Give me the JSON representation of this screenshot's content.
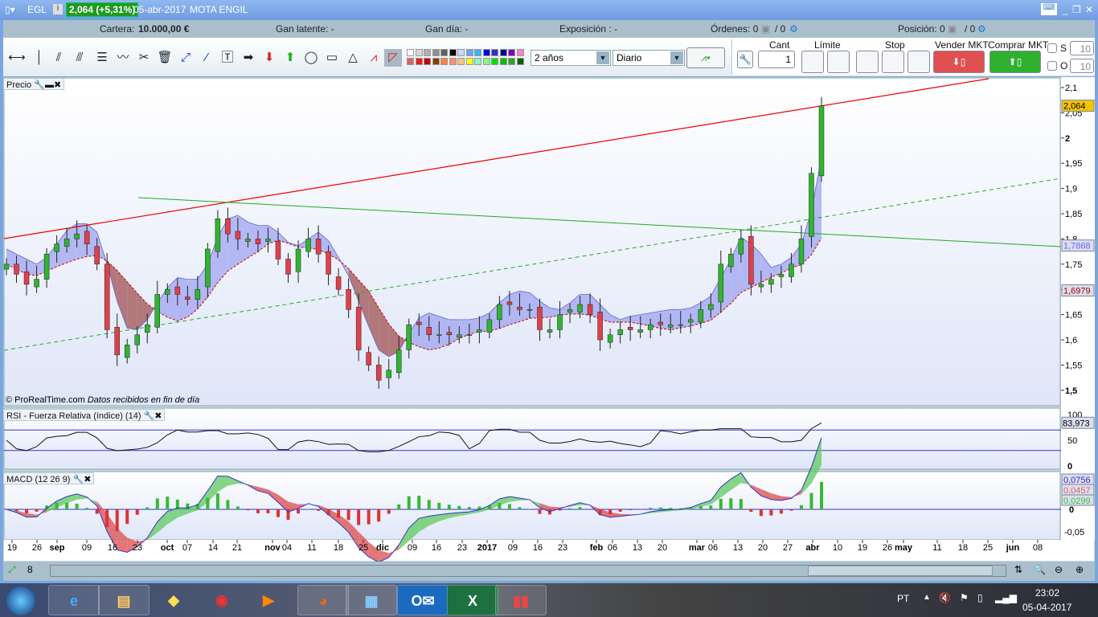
{
  "title": {
    "ticker": "EGL",
    "price": "2,064 (+5,31%)",
    "date": "05-abr-2017",
    "name": "MOTA ENGIL"
  },
  "info": {
    "cartera_label": "Cartera:",
    "cartera_value": "10.000,00 €",
    "gan_latente": "Gan latente: -",
    "gan_dia": "Gan día: -",
    "exposicion": "Exposición : -",
    "ordenes": "Órdenes: 0",
    "ordenes_b": "/ 0",
    "posicion": "Posición: 0",
    "posicion_b": "/ 0"
  },
  "toolbar": {
    "period": "2 años",
    "interval": "Diario",
    "cant_label": "Cant",
    "cant_value": "1",
    "limite_label": "Límite",
    "stop_label": "Stop",
    "sell_label": "Vender MKT",
    "buy_label": "Comprar MKT",
    "s_label": "S",
    "s_value": "10",
    "o_label": "O",
    "o_value": "10"
  },
  "colors": {
    "palette": [
      "#ffffff",
      "#d8d8d8",
      "#b0b0b0",
      "#909090",
      "#606060",
      "#000000",
      "#c8d8ff",
      "#6aa0ff",
      "#40b0ff",
      "#0000e0",
      "#3030c0",
      "#000090",
      "#8000c0",
      "#ff80c0",
      "#e06060",
      "#e02020",
      "#c00000",
      "#804000",
      "#ff8040",
      "#ff9070",
      "#ffc080",
      "#ffff00",
      "#80ffc0",
      "#80ff80",
      "#00e000",
      "#00c000",
      "#30a030",
      "#006000"
    ],
    "up": "#2fb52f",
    "down": "#e0404a"
  },
  "panels": {
    "price": "Precio",
    "rsi": "RSI - Fuerza Relativa (índice) (14)",
    "macd": "MACD (12 26 9)",
    "copyright": "© ProRealTime.com",
    "data_note": "Datos recibidos en fin de día"
  },
  "chart_data": [
    {
      "type": "candlestick",
      "title": "Precio",
      "ylim": [
        1.47,
        2.12
      ],
      "yticks": [
        "2,1",
        "2,05",
        "2",
        "1,95",
        "1,9",
        "1,85",
        "1,8",
        "1,75",
        "1,7",
        "1,65",
        "1,6",
        "1,55",
        "1,5"
      ],
      "ytick_values": [
        2.1,
        2.05,
        2,
        1.95,
        1.9,
        1.85,
        1.8,
        1.75,
        1.7,
        1.65,
        1.6,
        1.55,
        1.5
      ],
      "closes": [
        1.75,
        1.73,
        1.71,
        1.72,
        1.77,
        1.79,
        1.8,
        1.81,
        1.79,
        1.75,
        1.62,
        1.57,
        1.59,
        1.61,
        1.63,
        1.69,
        1.7,
        1.69,
        1.68,
        1.7,
        1.78,
        1.84,
        1.81,
        1.8,
        1.8,
        1.79,
        1.8,
        1.76,
        1.73,
        1.78,
        1.8,
        1.77,
        1.73,
        1.7,
        1.66,
        1.58,
        1.55,
        1.52,
        1.54,
        1.58,
        1.63,
        1.63,
        1.61,
        1.61,
        1.61,
        1.61,
        1.61,
        1.62,
        1.64,
        1.67,
        1.67,
        1.66,
        1.66,
        1.62,
        1.62,
        1.65,
        1.66,
        1.67,
        1.65,
        1.6,
        1.61,
        1.62,
        1.62,
        1.62,
        1.63,
        1.63,
        1.63,
        1.63,
        1.64,
        1.66,
        1.67,
        1.75,
        1.77,
        1.8,
        1.71,
        1.71,
        1.72,
        1.73,
        1.75,
        1.8,
        1.93,
        2.064
      ],
      "labels": {
        "last": "2,064",
        "line_green": "1,7868",
        "line_red": "1,6979"
      }
    },
    {
      "type": "line",
      "title": "RSI",
      "ylim": [
        0,
        100
      ],
      "yticks": [
        "100",
        "50",
        "0"
      ],
      "last": "83,973",
      "levels": [
        70,
        30
      ]
    },
    {
      "type": "bar",
      "title": "MACD",
      "yticks": [
        "0",
        "-0,05"
      ],
      "labels": [
        "0,0756",
        "0,0457",
        "0,0299"
      ]
    }
  ],
  "xaxis": [
    "19",
    "26",
    "sep",
    "09",
    "16",
    "23",
    "oct",
    "07",
    "14",
    "21",
    "nov",
    "04",
    "11",
    "18",
    "25",
    "dic",
    "09",
    "16",
    "23",
    "2017",
    "09",
    "16",
    "23",
    "feb",
    "06",
    "13",
    "20",
    "mar",
    "06",
    "13",
    "20",
    "27",
    "abr",
    "10",
    "19",
    "26",
    "may",
    "11",
    "18",
    "25",
    "jun",
    "08"
  ],
  "taskbar": {
    "lang": "PT",
    "time": "23:02",
    "date": "05-04-2017"
  }
}
